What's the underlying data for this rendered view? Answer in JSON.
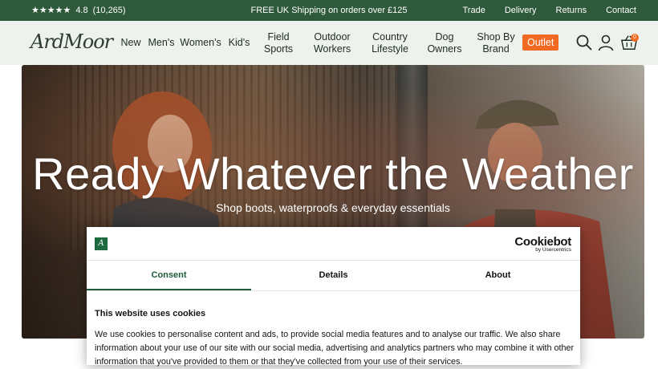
{
  "topbar": {
    "stars": "★★★★★",
    "rating": "4.8",
    "reviews": "(10,265)",
    "shipping": "FREE UK Shipping on orders over £125",
    "links": [
      "Trade",
      "Delivery",
      "Returns",
      "Contact"
    ]
  },
  "nav": {
    "logo": "ArdMoor",
    "items": [
      {
        "label": "New"
      },
      {
        "label": "Men's"
      },
      {
        "label": "Women's"
      },
      {
        "label": "Kid's"
      },
      {
        "label": "Field\nSports"
      },
      {
        "label": "Outdoor\nWorkers"
      },
      {
        "label": "Country\nLifestyle"
      },
      {
        "label": "Dog\nOwners"
      },
      {
        "label": "Shop By\nBrand"
      }
    ],
    "outlet": "Outlet",
    "basket_count": "0"
  },
  "hero": {
    "headline": "Ready Whatever the Weather",
    "subline": "Shop boots, waterproofs & everyday essentials"
  },
  "cookie": {
    "brand": "Cookiebot",
    "brand_sub": "by Usercentrics",
    "tabs": [
      "Consent",
      "Details",
      "About"
    ],
    "title": "This website uses cookies",
    "body": "We use cookies to personalise content and ads, to provide social media features and to analyse our traffic. We also share information about your use of our site with our social media, advertising and analytics partners who may combine it with other information that you've provided to them or that they've collected from your use of their services."
  },
  "colors": {
    "topbar": "#2e5a3b",
    "nav_bg": "#eef2ef",
    "outlet": "#f26a21",
    "consent_accent": "#1f5a3a"
  }
}
